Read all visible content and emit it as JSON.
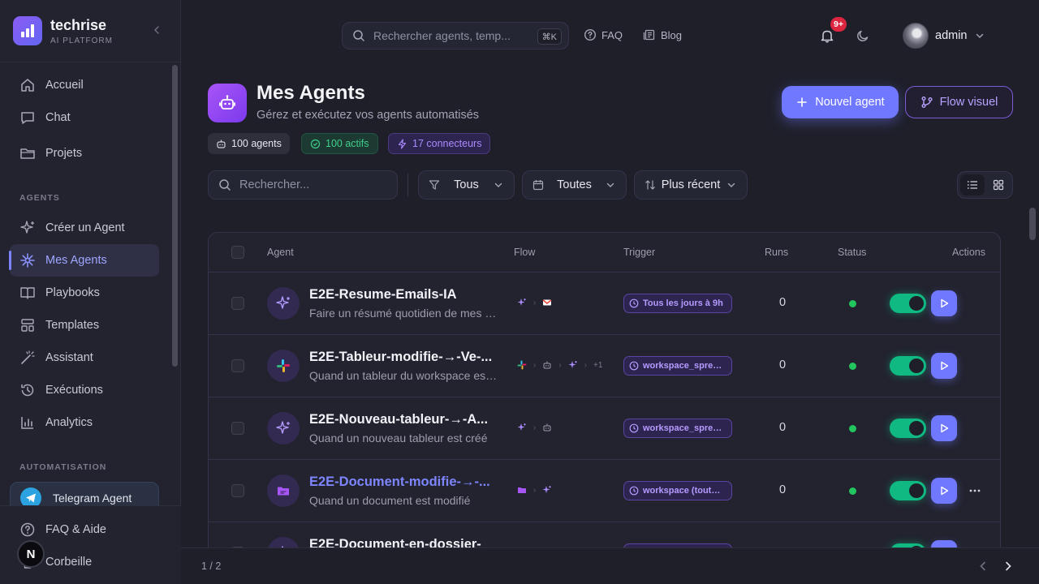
{
  "brand": {
    "name": "techrise",
    "subtitle": "AI PLATFORM"
  },
  "sidebar": {
    "main_items": [
      {
        "label": "Accueil",
        "icon": "home-icon"
      },
      {
        "label": "Chat",
        "icon": "chat-icon"
      },
      {
        "label": "Projets",
        "icon": "folder-icon"
      }
    ],
    "agents_section": "AGENTS",
    "agent_items": [
      {
        "label": "Créer un Agent",
        "icon": "sparkles-icon"
      },
      {
        "label": "Mes Agents",
        "icon": "asterisk-icon",
        "active": true
      },
      {
        "label": "Playbooks",
        "icon": "book-icon"
      },
      {
        "label": "Templates",
        "icon": "layout-icon"
      },
      {
        "label": "Assistant",
        "icon": "wand-icon"
      },
      {
        "label": "Exécutions",
        "icon": "history-icon"
      },
      {
        "label": "Analytics",
        "icon": "bar-chart-icon"
      }
    ],
    "automation_section": "AUTOMATISATION",
    "telegram_label": "Telegram Agent",
    "bottom_items": [
      {
        "label": "FAQ & Aide",
        "icon": "help-icon"
      },
      {
        "label": "Corbeille",
        "icon": "trash-icon"
      }
    ],
    "avatar_letter": "N"
  },
  "topbar": {
    "search_placeholder": "Rechercher agents, temp...",
    "search_shortcut": "⌘K",
    "faq_label": "FAQ",
    "blog_label": "Blog",
    "notification_count": "9+",
    "user_name": "admin"
  },
  "header": {
    "title": "Mes Agents",
    "subtitle": "Gérez et exécutez vos agents automatisés",
    "new_agent_label": "Nouvel agent",
    "flow_label": "Flow visuel",
    "stats": {
      "agents": "100 agents",
      "active": "100 actifs",
      "connectors": "17 connecteurs"
    }
  },
  "filters": {
    "search_placeholder": "Rechercher...",
    "status_value": "Tous",
    "date_value": "Toutes",
    "sort_value": "Plus récent"
  },
  "table": {
    "columns": {
      "agent": "Agent",
      "flow": "Flow",
      "trigger": "Trigger",
      "runs": "Runs",
      "status": "Status",
      "actions": "Actions"
    },
    "rows": [
      {
        "name": "E2E-Resume-Emails-IA",
        "description": "Faire un résumé quotidien de mes emails",
        "trigger": "Tous les jours à 9h",
        "runs": "0",
        "flow_extra": ""
      },
      {
        "name": "E2E-Tableur-modifie-→-Ve-...",
        "description": "Quand un tableur du workspace est modifié",
        "trigger": "workspace_spreadsheet",
        "runs": "0",
        "flow_extra": "+1"
      },
      {
        "name": "E2E-Nouveau-tableur-→-A...",
        "description": "Quand un nouveau tableur est créé",
        "trigger": "workspace_spreadsheet",
        "runs": "0",
        "flow_extra": ""
      },
      {
        "name": "E2E-Document-modifie-→-...",
        "description": "Quand un document est modifié",
        "trigger": "workspace (toutes)",
        "runs": "0",
        "flow_extra": ""
      },
      {
        "name": "E2E-Document-en-dossier-",
        "description": "",
        "trigger": "",
        "runs": "",
        "flow_extra": ""
      }
    ]
  },
  "pagination": {
    "label": "1 / 2"
  },
  "colors": {
    "accent": "#7078ff",
    "purple": "#a98bff",
    "green": "#10b981",
    "danger": "#dc2640"
  }
}
